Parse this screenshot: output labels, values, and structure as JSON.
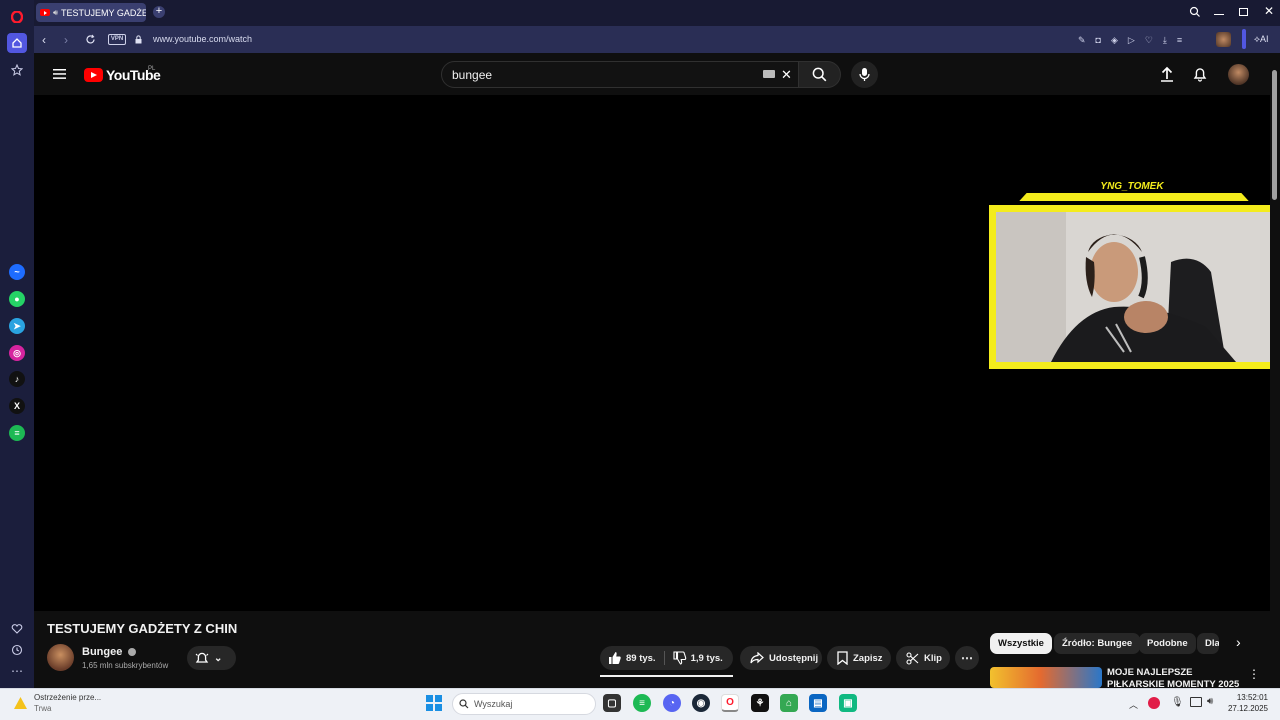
{
  "browser": {
    "tab_title": "TESTUJEMY GADŻETY",
    "url": "www.youtube.com/watch",
    "vpn_label": "VPN",
    "ai_label": "AI"
  },
  "youtube": {
    "logo_text": "YouTube",
    "region": "PL",
    "search_value": "bungee"
  },
  "video": {
    "title": "TESTUJEMY GADŻETY Z CHIN",
    "channel_name": "Bungee",
    "subscribers": "1,65 mln subskrybentów",
    "likes": "89 tys.",
    "dislikes": "1,9 tys.",
    "share_label": "Udostępnij",
    "save_label": "Zapisz",
    "clip_label": "Klip",
    "webcam_name": "YNG_TOMEK"
  },
  "chips": [
    "Wszystkie",
    "Źródło: Bungee",
    "Podobne",
    "Dla"
  ],
  "related": {
    "title": "MOJE NAJLEPSZE PIŁKARSKIE MOMENTY 2025"
  },
  "taskbar": {
    "notification_title": "Ostrzeżenie prze...",
    "notification_status": "Trwa",
    "search_placeholder": "Wyszukaj",
    "time": "13:52:01",
    "date": "27.12.2025"
  },
  "colors": {
    "opera_red": "#ff1b2d",
    "youtube_red": "#ff0000",
    "webcam_frame": "#f4ec1c",
    "background": "#0f0f0f"
  }
}
